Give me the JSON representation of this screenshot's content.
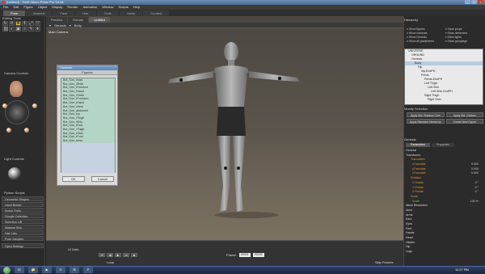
{
  "window": {
    "title": "[Untitled] - Smith Micro Poser Pro",
    "title_suffix": "64-bit",
    "controls": [
      "_",
      "□",
      "×"
    ]
  },
  "menu": [
    "File",
    "Edit",
    "Figure",
    "Object",
    "Display",
    "Render",
    "Animation",
    "Window",
    "Scripts",
    "Help"
  ],
  "rooms": [
    {
      "label": "Pose",
      "active": true
    },
    {
      "label": "Material",
      "active": false
    },
    {
      "label": "Face",
      "active": false
    },
    {
      "label": "Hair",
      "active": false
    },
    {
      "label": "Cloth",
      "active": false
    },
    {
      "label": "Setup",
      "active": false
    },
    {
      "label": "Content",
      "active": false
    }
  ],
  "doc_tabs": [
    {
      "label": "Preview",
      "active": false
    },
    {
      "label": "Render",
      "active": false
    },
    {
      "label": "Untitled",
      "active": true
    }
  ],
  "left": {
    "editing_tools": "Editing Tools",
    "tool_icons": [
      "rotate-icon",
      "twist-icon",
      "translate-icon",
      "translate-in-out-icon",
      "scale-icon",
      "taper-icon",
      "chain-break-icon",
      "color-icon",
      "grouping-icon",
      "view-magnifier-icon",
      "morphing-icon",
      "direct-manipulation-icon"
    ],
    "camera_controls": "Camera Controls",
    "light_controls": "Light Controls",
    "library": "Python Scripts",
    "library_items": [
      "Geometric Shapes",
      "Hand Builder",
      "Scene Fonts",
      "Google Collection",
      "Selection LIB",
      "Material Sets",
      "Hair Lists",
      "Pose Samples"
    ],
    "library_bottom": "Open Settings"
  },
  "viewport": {
    "figure_menu": "Genesis",
    "part_menu": "Body",
    "camera_label": "Main Camera"
  },
  "figures_dialog": {
    "title": "Conform",
    "header": "Figures",
    "items": [
      "Bot_Gen_head",
      "Bot_Gen_lShldr",
      "Bot_Gen_lForeArm",
      "Bot_Gen_lHand",
      "Bot_Gen_rShldr",
      "Bot_Gen_rForeArm",
      "Bot_Gen_rHand",
      "Bot_Gen_chest",
      "Bot_Gen_abdomen",
      "Bot_Gen_hip",
      "Bot_Gen_lThigh",
      "Bot_Gen_lShin",
      "Bot_Gen_lFoot",
      "Bot_Gen_rThigh",
      "Bot_Gen_rShin",
      "Bot_Gen_rFoot",
      "Bot_Gen_torso"
    ],
    "ok": "OK",
    "cancel": "Cancel"
  },
  "timeline": {
    "frame_label": "Frame:",
    "frame_current": "00001",
    "frame_total": "00030",
    "loop": "Loop",
    "skip_frames": "Skip Frames",
    "ui_dots": "UI Dots",
    "play_buttons": [
      "⏮",
      "◀",
      "▶",
      "⏭",
      "■"
    ]
  },
  "right": {
    "hierarchy_title": "Hierarchy",
    "options": [
      "Show figures",
      "Show props",
      "Show cameras",
      "Show deformers",
      "Show Genesis",
      "Show lights",
      "Show all parameters",
      "Show groupings"
    ],
    "tree": [
      {
        "label": "UNIVERSE",
        "selected": false
      },
      {
        "label": "GROUND",
        "selected": false
      },
      {
        "label": "Genesis",
        "selected": false
      },
      {
        "label": "Body",
        "selected": true
      },
      {
        "label": "Hip",
        "selected": false
      },
      {
        "label": "hip-EndPH",
        "selected": false
      },
      {
        "label": "Pelvis",
        "selected": false
      },
      {
        "label": "Pelvis-EndPH",
        "selected": false
      },
      {
        "label": "Left Thigh",
        "selected": false
      },
      {
        "label": "Left Shin",
        "selected": false
      },
      {
        "label": "Left Shin-EndPH",
        "selected": false
      },
      {
        "label": "Right Thigh",
        "selected": false
      },
      {
        "label": "Right Shin",
        "selected": false
      }
    ],
    "modify_selection": "Modify Selection",
    "modify_buttons": [
      "Apply Std. Shadow Cam",
      "Apply Std. Clothes",
      "Apply Standard Hierarchy",
      "Create New Figure"
    ],
    "params_title": "Genesis",
    "param_tabs": [
      {
        "label": "Parameters",
        "active": true
      },
      {
        "label": "Properties",
        "active": false
      }
    ],
    "params": [
      {
        "label": "General",
        "kind": "head",
        "value": ""
      },
      {
        "label": "Transforms",
        "kind": "head",
        "value": ""
      },
      {
        "label": "Translation",
        "kind": "sub2",
        "value": ""
      },
      {
        "label": "xTranslate",
        "kind": "sub",
        "value": "0.000"
      },
      {
        "label": "yTranslate",
        "kind": "sub",
        "value": "0.000"
      },
      {
        "label": "zTranslate",
        "kind": "sub",
        "value": "0.000"
      },
      {
        "label": "Rotation",
        "kind": "sub2",
        "value": ""
      },
      {
        "label": "X Rotate",
        "kind": "sub",
        "value": "0 °"
      },
      {
        "label": "Y Rotate",
        "kind": "sub",
        "value": "0 °"
      },
      {
        "label": "Z Rotate",
        "kind": "sub",
        "value": "0 °"
      },
      {
        "label": "Scale",
        "kind": "sub2",
        "value": ""
      },
      {
        "label": "Scale",
        "kind": "dial",
        "value": "100 %"
      },
      {
        "label": "Mesh Resolution",
        "kind": "head",
        "value": ""
      },
      {
        "label": "Actor",
        "kind": "head",
        "value": ""
      },
      {
        "label": "Arms",
        "kind": "head",
        "value": ""
      },
      {
        "label": "Ears",
        "kind": "head",
        "value": ""
      },
      {
        "label": "Eyes",
        "kind": "head",
        "value": ""
      },
      {
        "label": "Feet",
        "kind": "head",
        "value": ""
      },
      {
        "label": "Hands",
        "kind": "head",
        "value": ""
      },
      {
        "label": "Head",
        "kind": "head",
        "value": ""
      },
      {
        "label": "Hidden",
        "kind": "head",
        "value": ""
      },
      {
        "label": "Hip",
        "kind": "head",
        "value": ""
      },
      {
        "label": "Legs",
        "kind": "head",
        "value": ""
      }
    ]
  },
  "taskbar": {
    "apps": [
      "IE",
      "📁",
      "▶",
      "G",
      "✉",
      "P"
    ],
    "time": "11:27 PM"
  }
}
